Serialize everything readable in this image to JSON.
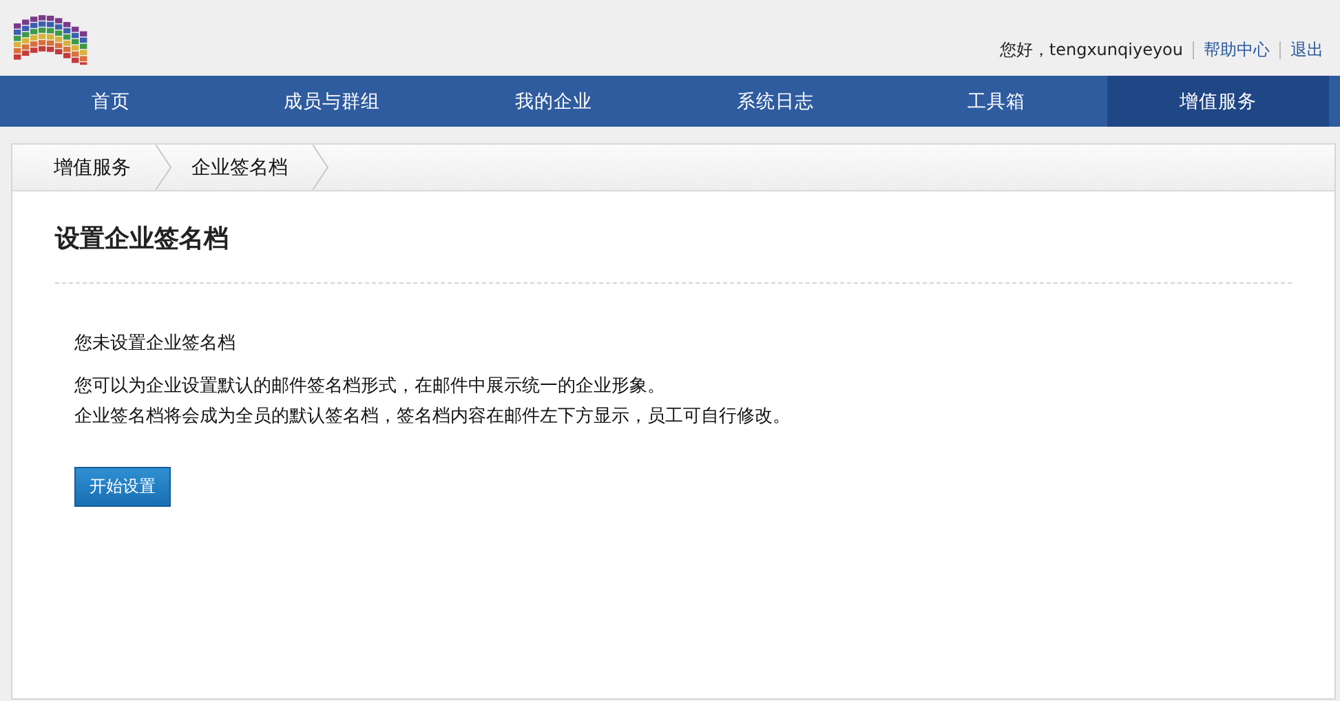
{
  "header": {
    "greeting": "您好，tengxunqiyeyou",
    "links": [
      "帮助中心",
      "退出"
    ]
  },
  "nav": [
    {
      "label": "首页",
      "selected": false
    },
    {
      "label": "成员与群组",
      "selected": false
    },
    {
      "label": "我的企业",
      "selected": false
    },
    {
      "label": "系统日志",
      "selected": false
    },
    {
      "label": "工具箱",
      "selected": false
    },
    {
      "label": "增值服务",
      "selected": true
    }
  ],
  "breadcrumb": [
    "增值服务",
    "企业签名档"
  ],
  "page": {
    "title": "设置企业签名档",
    "status": "您未设置企业签名档",
    "paragraphs": [
      "您可以为企业设置默认的邮件签名档形式，在邮件中展示统一的企业形象。",
      "企业签名档将会成为全员的默认签名档，签名档内容在邮件左下方显示，员工可自行修改。"
    ],
    "button": "开始设置"
  }
}
